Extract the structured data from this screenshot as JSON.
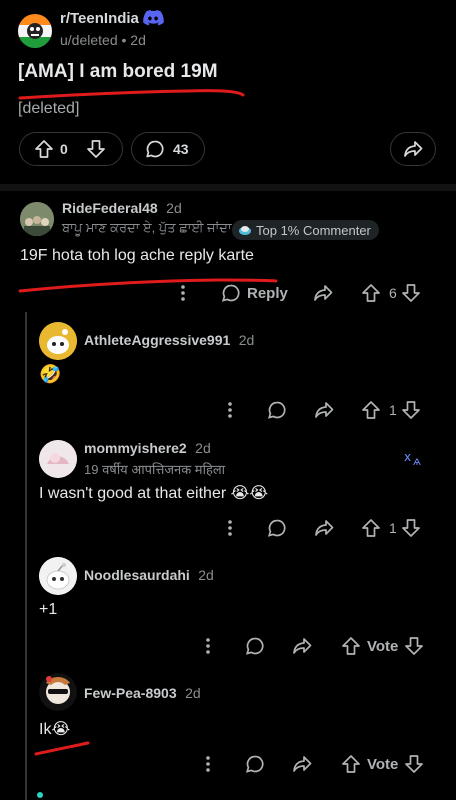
{
  "post": {
    "subreddit": "r/TeenIndia",
    "author": "u/deleted",
    "age": "2d",
    "title": "[AMA] I am bored 19M",
    "body": "[deleted]",
    "score": "0",
    "comments": "43"
  },
  "comments": [
    {
      "username": "RideFederal48",
      "age": "2d",
      "flair": "ਬਾਪੂ ਮਾਣ ਕਰਦਾ ਏ, ਪੁੱਤ ਛਾਈ ਜਾਂਦਾ",
      "badge": "Top 1% Commenter",
      "text": "19F hota toh log ache reply karte",
      "reply_label": "Reply",
      "score": "6"
    },
    {
      "username": "AthleteAggressive991",
      "age": "2d",
      "text": "🤣",
      "score": "1"
    },
    {
      "username": "mommyishere2",
      "age": "2d",
      "flair": "19 वर्षीय आपत्तिजनक महिला",
      "text": "I wasn't good at that either 😭😭",
      "score": "1"
    },
    {
      "username": "Noodlesaurdahi",
      "age": "2d",
      "text": "+1",
      "vote_label": "Vote"
    },
    {
      "username": "Few-Pea-8903",
      "age": "2d",
      "text": "Ik😭",
      "vote_label": "Vote"
    }
  ],
  "colors": {
    "accent_discord": "#5865F2",
    "annotation_red": "#e01b1b",
    "background": "#000000"
  }
}
